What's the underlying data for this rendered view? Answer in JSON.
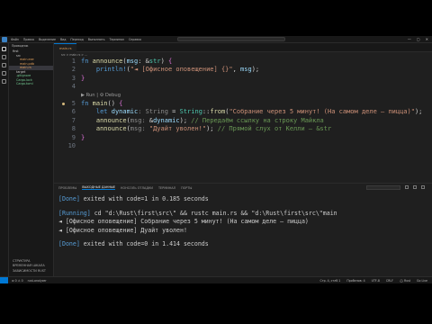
{
  "titlebar": {
    "menu": [
      "Файл",
      "Правка",
      "Выделение",
      "Вид",
      "Переход",
      "Выполнить",
      "Терминал",
      "Справка"
    ],
    "window_buttons": [
      "—",
      "▢",
      "✕"
    ]
  },
  "sidebar": {
    "header": "Проводник",
    "items": [
      {
        "label": "first",
        "cls": ""
      },
      {
        "label": "src",
        "cls": "indent"
      },
      {
        "label": "main.exe",
        "cls": "indent2 orange"
      },
      {
        "label": "main.pdb",
        "cls": "indent2 orange"
      },
      {
        "label": "main.rs",
        "cls": "indent2 orange sel"
      },
      {
        "label": "target",
        "cls": "indent"
      },
      {
        "label": ".gitignore",
        "cls": "indent green"
      },
      {
        "label": "Cargo.lock",
        "cls": "indent green"
      },
      {
        "label": "Cargo.toml",
        "cls": "indent green"
      }
    ],
    "bottom": [
      "СТРУКТУРА",
      "ВРЕМЕННАЯ ШКАЛА",
      "ЗАВИСИМОСТИ RUST"
    ]
  },
  "editor": {
    "tab_label": "main.rs",
    "breadcrumb": "src > main.rs > ...",
    "code_lens": "▶ Run | ⚙ Debug",
    "lines": [
      {
        "n": "1",
        "html": "<span class=\"kw\">fn</span> <span class=\"fn\">announce</span><span class=\"punc\">(</span><span class=\"var\">msg</span><span class=\"punc\">: &amp;</span><span class=\"ty\">str</span><span class=\"punc\">) </span><span class=\"br\">{</span>"
      },
      {
        "n": "2",
        "html": "    <span class=\"mac\">println!</span><span class=\"punc\">(</span><span class=\"str\">\"◄ [Офисное оповещение] {}\"</span><span class=\"punc\">, </span><span class=\"var\">msg</span><span class=\"punc\">);</span>"
      },
      {
        "n": "3",
        "html": "<span class=\"br\">}</span>"
      },
      {
        "n": "4",
        "html": ""
      },
      {
        "n": "5",
        "html": "<span class=\"kw\">fn</span> <span class=\"fn\">main</span><span class=\"punc\">() </span><span class=\"br\">{</span>"
      },
      {
        "n": "6",
        "html": "    <span class=\"kw\">let</span> <span class=\"var\">dynamic</span><span class=\"hint\">: String</span><span class=\"punc\"> = </span><span class=\"ty\">String</span><span class=\"punc\">::</span><span class=\"fn\">from</span><span class=\"punc\">(</span><span class=\"str\">\"Собрание через 5 минут! (На самом деле — пицца)\"</span><span class=\"punc\">);</span>"
      },
      {
        "n": "7",
        "html": "    <span class=\"fn\">announce</span><span class=\"punc\">(</span><span class=\"hint\">msg: </span><span class=\"punc\">&amp;</span><span class=\"var\">dynamic</span><span class=\"punc\">); </span><span class=\"cmt\">// Передаём ссылку на строку Майкла</span>"
      },
      {
        "n": "8",
        "html": "    <span class=\"fn\">announce</span><span class=\"punc\">(</span><span class=\"hint\">msg: </span><span class=\"str\">\"Дуайт уволен!\"</span><span class=\"punc\">); </span><span class=\"cmt\">// Прямой слух от Келли — &amp;str</span>"
      },
      {
        "n": "9",
        "html": "<span class=\"br\">}</span>"
      },
      {
        "n": "10",
        "html": ""
      }
    ]
  },
  "panel": {
    "tabs": [
      "ПРОБЛЕМЫ",
      "ВЫХОДНЫЕ ДАННЫЕ",
      "КОНСОЛЬ ОТЛАДКИ",
      "ТЕРМИНАЛ",
      "ПОРТЫ"
    ],
    "active_tab": 1,
    "output": [
      {
        "kind": "status",
        "tag": "[Done]",
        "text": " exited with code=1 in 0.185 seconds"
      },
      {
        "kind": "blank"
      },
      {
        "kind": "status",
        "tag": "[Running]",
        "text": " cd \"d:\\Rust\\first\\src\\\" && rustc main.rs && \"d:\\Rust\\first\\src\\\"main"
      },
      {
        "kind": "plain",
        "text": "◄ [Офисное оповещение] Собрание через 5 минут! (На самом деле — пицца)"
      },
      {
        "kind": "plain",
        "text": "◄ [Офисное оповещение] Дуайт уволен!"
      },
      {
        "kind": "blank"
      },
      {
        "kind": "status",
        "tag": "[Done]",
        "text": " exited with code=0 in 1.414 seconds"
      }
    ]
  },
  "statusbar": {
    "left": [
      "⊗ 0 ⚠ 0",
      "rust-analyzer"
    ],
    "right": [
      "Стр. 4, стлб 1",
      "Пробелов: 4",
      "UTF-8",
      "CRLF",
      "{} Rust",
      "Go Live"
    ]
  }
}
